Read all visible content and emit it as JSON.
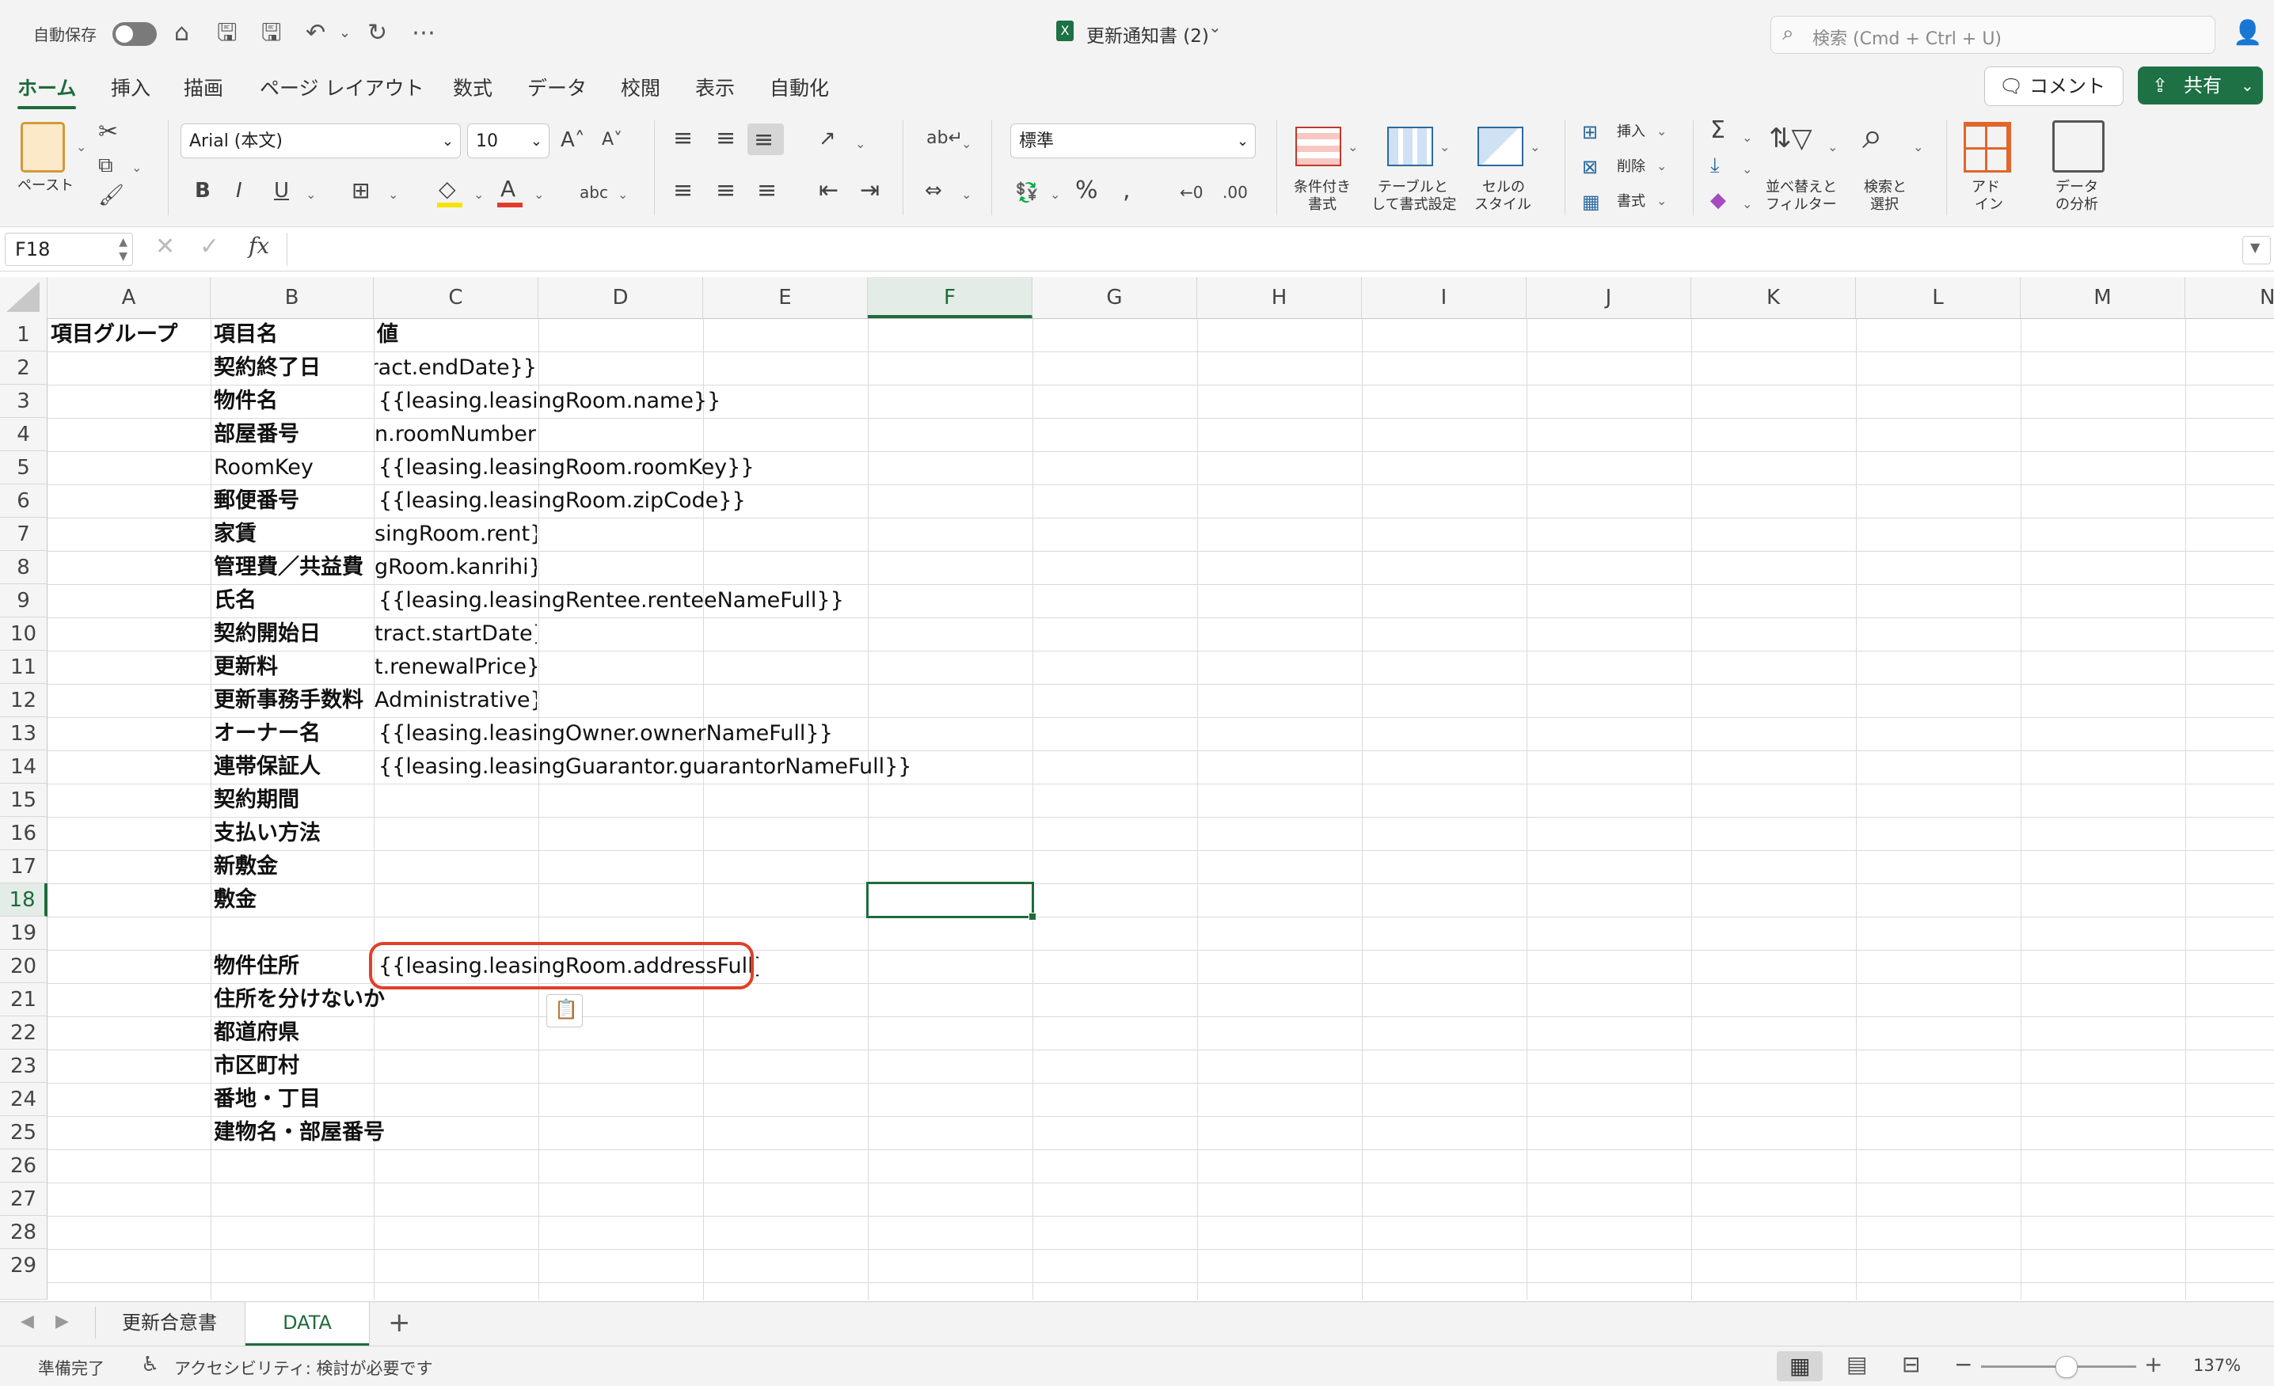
{
  "titlebar": {
    "autosave_label": "自動保存",
    "file_name": "更新通知書 (2)",
    "search_placeholder": "検索 (Cmd + Ctrl + U)"
  },
  "ribbon_tabs": [
    "ホーム",
    "挿入",
    "描画",
    "ページ レイアウト",
    "数式",
    "データ",
    "校閲",
    "表示",
    "自動化"
  ],
  "actions": {
    "comment": "コメント",
    "share": "共有"
  },
  "ribbon": {
    "paste": "ペースト",
    "font_name": "Arial (本文)",
    "font_size": "10",
    "number_format": "標準",
    "insert": "挿入",
    "delete": "削除",
    "format": "書式",
    "cond_format": [
      "条件付き",
      "書式"
    ],
    "table_format": [
      "テーブルと",
      "して書式設定"
    ],
    "cell_style": [
      "セルの",
      "スタイル"
    ],
    "sort_filter": [
      "並べ替えと",
      "フィルター"
    ],
    "find_select": [
      "検索と",
      "選択"
    ],
    "addin": [
      "アド",
      "イン"
    ],
    "analyze": [
      "データ",
      "の分析"
    ]
  },
  "formula_bar": {
    "name_box": "F18",
    "fx": "fx",
    "value": ""
  },
  "columns": [
    "A",
    "B",
    "C",
    "D",
    "E",
    "F",
    "G",
    "H",
    "I",
    "J",
    "K",
    "L",
    "M",
    "N"
  ],
  "rows": [
    "1",
    "2",
    "3",
    "4",
    "5",
    "6",
    "7",
    "8",
    "9",
    "10",
    "11",
    "12",
    "13",
    "14",
    "15",
    "16",
    "17",
    "18",
    "19",
    "20",
    "21",
    "22",
    "23",
    "24",
    "25",
    "26",
    "27",
    "28",
    "29"
  ],
  "cells": {
    "A1": "項目グループ",
    "B1": "項目名",
    "C1": "値",
    "B2": "契約終了日",
    "C2": "ntract.endDate}}",
    "B3": "物件名",
    "C3": "{{leasing.leasingRoom.name}}",
    "B4": "部屋番号",
    "C4": "n.roomNumber}}",
    "B5": "RoomKey",
    "C5": "{{leasing.leasingRoom.roomKey}}",
    "B6": "郵便番号",
    "C6": "{{leasing.leasingRoom.zipCode}}",
    "B7": "家賃",
    "C7": "singRoom.rent}}",
    "B8": "管理費／共益費",
    "C8": "gRoom.kanrihi}}",
    "B9": "氏名",
    "C9": "{{leasing.leasingRentee.renteeNameFull}}",
    "B10": "契約開始日",
    "C10": "tract.startDate}}",
    "B11": "更新料",
    "C11": "t.renewalPrice}}",
    "B12": "更新事務手数料",
    "C12": "Administrative}}",
    "B13": "オーナー名",
    "C13": "{{leasing.leasingOwner.ownerNameFull}}",
    "B14": "連帯保証人",
    "C14": "{{leasing.leasingGuarantor.guarantorNameFull}}",
    "B15": "契約期間",
    "B16": "支払い方法",
    "B17": "新敷金",
    "B18": "敷金",
    "B20": "物件住所",
    "C20": "{{leasing.leasingRoom.addressFull}}",
    "B21": "住所を分けないか",
    "B22": "都道府県",
    "B23": "市区町村",
    "B24": "番地・丁目",
    "B25": "建物名・部屋番号"
  },
  "sheets": [
    "更新合意書",
    "DATA"
  ],
  "active_sheet": "DATA",
  "status": {
    "ready": "準備完了",
    "accessibility": "アクセシビリティ: 検討が必要です",
    "zoom": "137%"
  },
  "colors": {
    "accent": "#1e6b3c",
    "highlight_ring": "#e0402a"
  }
}
